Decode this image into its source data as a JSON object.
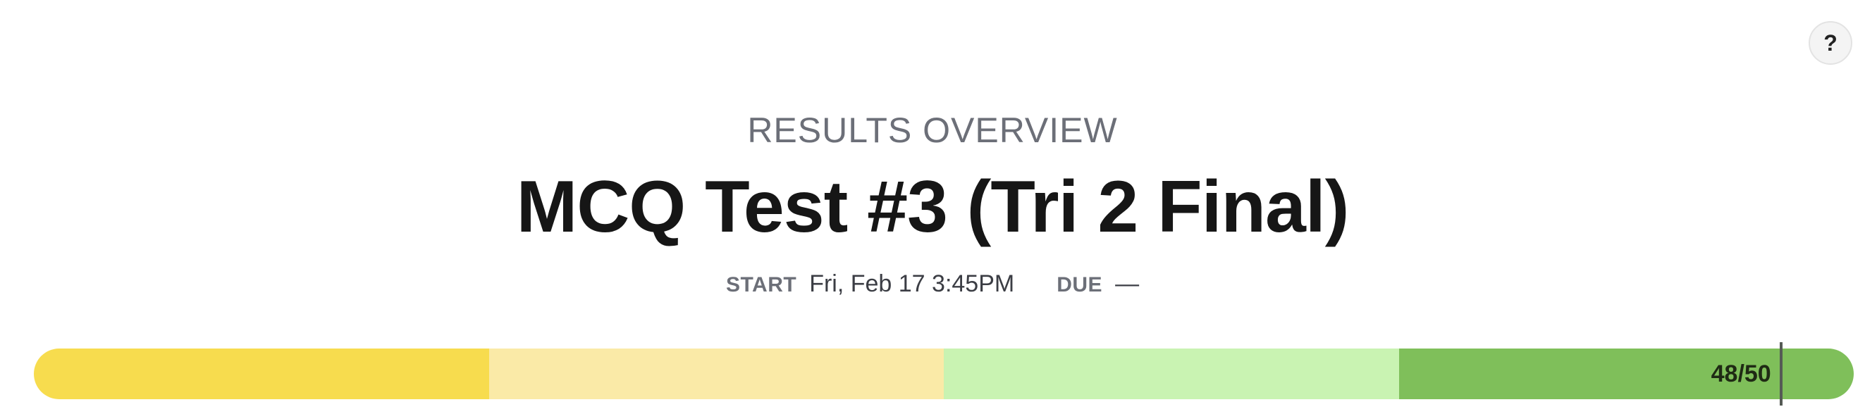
{
  "help": {
    "label": "?"
  },
  "header": {
    "overline": "RESULTS OVERVIEW",
    "title": "MCQ Test #3 (Tri 2 Final)"
  },
  "meta": {
    "start_label": "START",
    "start_value": "Fri, Feb 17 3:45PM",
    "due_label": "DUE",
    "due_value": "—"
  },
  "score": {
    "label": "48/50",
    "points": 48,
    "max": 50,
    "fraction": 0.96
  },
  "bands": [
    {
      "name": "band-1",
      "color": "#f7dc4e"
    },
    {
      "name": "band-2",
      "color": "#faeaa7"
    },
    {
      "name": "band-3",
      "color": "#c9f3b2"
    },
    {
      "name": "band-4",
      "color": "#7fbf5a"
    }
  ]
}
